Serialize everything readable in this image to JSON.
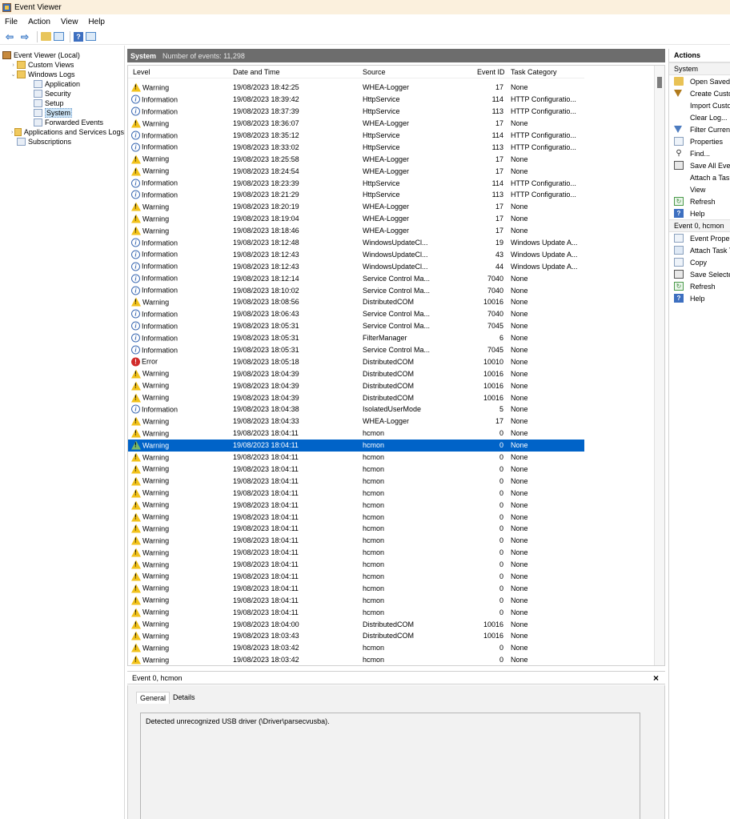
{
  "window": {
    "title": "Event Viewer"
  },
  "menu": [
    "File",
    "Action",
    "View",
    "Help"
  ],
  "tree": [
    {
      "label": "Event Viewer (Local)",
      "indent": 0,
      "chev": "",
      "icon": "root",
      "name": "tree-event-viewer-local"
    },
    {
      "label": "Custom Views",
      "indent": 1,
      "chev": "›",
      "icon": "folder",
      "name": "tree-custom-views"
    },
    {
      "label": "Windows Logs",
      "indent": 1,
      "chev": "⌄",
      "icon": "folder",
      "name": "tree-windows-logs"
    },
    {
      "label": "Application",
      "indent": 2,
      "chev": "",
      "icon": "log",
      "name": "tree-application"
    },
    {
      "label": "Security",
      "indent": 2,
      "chev": "",
      "icon": "log",
      "name": "tree-security"
    },
    {
      "label": "Setup",
      "indent": 2,
      "chev": "",
      "icon": "log",
      "name": "tree-setup"
    },
    {
      "label": "System",
      "indent": 2,
      "chev": "",
      "icon": "log",
      "name": "tree-system",
      "selected": true
    },
    {
      "label": "Forwarded Events",
      "indent": 2,
      "chev": "",
      "icon": "log",
      "name": "tree-forwarded-events"
    },
    {
      "label": "Applications and Services Logs",
      "indent": 1,
      "chev": "›",
      "icon": "folder",
      "name": "tree-applications-services-logs"
    },
    {
      "label": "Subscriptions",
      "indent": 1,
      "chev": "",
      "icon": "log",
      "name": "tree-subscriptions"
    }
  ],
  "center": {
    "log_name": "System",
    "count_label": "Number of events: 11,298",
    "columns": {
      "level": "Level",
      "date": "Date and Time",
      "source": "Source",
      "event_id": "Event ID",
      "category": "Task Category"
    },
    "selected_index": 30,
    "rows": [
      [
        "Warning",
        "19/08/2023 18:42:25",
        "WHEA-Logger",
        "17",
        "None"
      ],
      [
        "Information",
        "19/08/2023 18:39:42",
        "HttpService",
        "114",
        "HTTP Configuratio..."
      ],
      [
        "Information",
        "19/08/2023 18:37:39",
        "HttpService",
        "113",
        "HTTP Configuratio..."
      ],
      [
        "Warning",
        "19/08/2023 18:36:07",
        "WHEA-Logger",
        "17",
        "None"
      ],
      [
        "Information",
        "19/08/2023 18:35:12",
        "HttpService",
        "114",
        "HTTP Configuratio..."
      ],
      [
        "Information",
        "19/08/2023 18:33:02",
        "HttpService",
        "113",
        "HTTP Configuratio..."
      ],
      [
        "Warning",
        "19/08/2023 18:25:58",
        "WHEA-Logger",
        "17",
        "None"
      ],
      [
        "Warning",
        "19/08/2023 18:24:54",
        "WHEA-Logger",
        "17",
        "None"
      ],
      [
        "Information",
        "19/08/2023 18:23:39",
        "HttpService",
        "114",
        "HTTP Configuratio..."
      ],
      [
        "Information",
        "19/08/2023 18:21:29",
        "HttpService",
        "113",
        "HTTP Configuratio..."
      ],
      [
        "Warning",
        "19/08/2023 18:20:19",
        "WHEA-Logger",
        "17",
        "None"
      ],
      [
        "Warning",
        "19/08/2023 18:19:04",
        "WHEA-Logger",
        "17",
        "None"
      ],
      [
        "Warning",
        "19/08/2023 18:18:46",
        "WHEA-Logger",
        "17",
        "None"
      ],
      [
        "Information",
        "19/08/2023 18:12:48",
        "WindowsUpdateCl...",
        "19",
        "Windows Update A..."
      ],
      [
        "Information",
        "19/08/2023 18:12:43",
        "WindowsUpdateCl...",
        "43",
        "Windows Update A..."
      ],
      [
        "Information",
        "19/08/2023 18:12:43",
        "WindowsUpdateCl...",
        "44",
        "Windows Update A..."
      ],
      [
        "Information",
        "19/08/2023 18:12:14",
        "Service Control Ma...",
        "7040",
        "None"
      ],
      [
        "Information",
        "19/08/2023 18:10:02",
        "Service Control Ma...",
        "7040",
        "None"
      ],
      [
        "Warning",
        "19/08/2023 18:08:56",
        "DistributedCOM",
        "10016",
        "None"
      ],
      [
        "Information",
        "19/08/2023 18:06:43",
        "Service Control Ma...",
        "7040",
        "None"
      ],
      [
        "Information",
        "19/08/2023 18:05:31",
        "Service Control Ma...",
        "7045",
        "None"
      ],
      [
        "Information",
        "19/08/2023 18:05:31",
        "FilterManager",
        "6",
        "None"
      ],
      [
        "Information",
        "19/08/2023 18:05:31",
        "Service Control Ma...",
        "7045",
        "None"
      ],
      [
        "Error",
        "19/08/2023 18:05:18",
        "DistributedCOM",
        "10010",
        "None"
      ],
      [
        "Warning",
        "19/08/2023 18:04:39",
        "DistributedCOM",
        "10016",
        "None"
      ],
      [
        "Warning",
        "19/08/2023 18:04:39",
        "DistributedCOM",
        "10016",
        "None"
      ],
      [
        "Warning",
        "19/08/2023 18:04:39",
        "DistributedCOM",
        "10016",
        "None"
      ],
      [
        "Information",
        "19/08/2023 18:04:38",
        "IsolatedUserMode",
        "5",
        "None"
      ],
      [
        "Warning",
        "19/08/2023 18:04:33",
        "WHEA-Logger",
        "17",
        "None"
      ],
      [
        "Warning",
        "19/08/2023 18:04:11",
        "hcmon",
        "0",
        "None"
      ],
      [
        "Warning",
        "19/08/2023 18:04:11",
        "hcmon",
        "0",
        "None"
      ],
      [
        "Warning",
        "19/08/2023 18:04:11",
        "hcmon",
        "0",
        "None"
      ],
      [
        "Warning",
        "19/08/2023 18:04:11",
        "hcmon",
        "0",
        "None"
      ],
      [
        "Warning",
        "19/08/2023 18:04:11",
        "hcmon",
        "0",
        "None"
      ],
      [
        "Warning",
        "19/08/2023 18:04:11",
        "hcmon",
        "0",
        "None"
      ],
      [
        "Warning",
        "19/08/2023 18:04:11",
        "hcmon",
        "0",
        "None"
      ],
      [
        "Warning",
        "19/08/2023 18:04:11",
        "hcmon",
        "0",
        "None"
      ],
      [
        "Warning",
        "19/08/2023 18:04:11",
        "hcmon",
        "0",
        "None"
      ],
      [
        "Warning",
        "19/08/2023 18:04:11",
        "hcmon",
        "0",
        "None"
      ],
      [
        "Warning",
        "19/08/2023 18:04:11",
        "hcmon",
        "0",
        "None"
      ],
      [
        "Warning",
        "19/08/2023 18:04:11",
        "hcmon",
        "0",
        "None"
      ],
      [
        "Warning",
        "19/08/2023 18:04:11",
        "hcmon",
        "0",
        "None"
      ],
      [
        "Warning",
        "19/08/2023 18:04:11",
        "hcmon",
        "0",
        "None"
      ],
      [
        "Warning",
        "19/08/2023 18:04:11",
        "hcmon",
        "0",
        "None"
      ],
      [
        "Warning",
        "19/08/2023 18:04:11",
        "hcmon",
        "0",
        "None"
      ],
      [
        "Warning",
        "19/08/2023 18:04:00",
        "DistributedCOM",
        "10016",
        "None"
      ],
      [
        "Warning",
        "19/08/2023 18:03:43",
        "DistributedCOM",
        "10016",
        "None"
      ],
      [
        "Warning",
        "19/08/2023 18:03:42",
        "hcmon",
        "0",
        "None"
      ],
      [
        "Warning",
        "19/08/2023 18:03:42",
        "hcmon",
        "0",
        "None"
      ],
      [
        "Warning",
        "19/08/2023 18:03:42",
        "hcmon",
        "0",
        "None"
      ]
    ]
  },
  "detail": {
    "title": "Event 0, hcmon",
    "close": "×",
    "tabs": [
      "General",
      "Details"
    ],
    "message": "Detected unrecognized USB driver (\\Driver\\parsecvusba)."
  },
  "actions": {
    "title": "Actions",
    "section1": "System",
    "items1": [
      {
        "label": "Open Saved Log...",
        "icon": "folder",
        "name": "action-open-saved-log"
      },
      {
        "label": "Create Custom View...",
        "icon": "filter",
        "name": "action-create-custom-view"
      },
      {
        "label": "Import Custom View...",
        "icon": "none",
        "name": "action-import-custom-view"
      },
      {
        "label": "Clear Log...",
        "icon": "none",
        "name": "action-clear-log"
      },
      {
        "label": "Filter Current Log...",
        "icon": "filter-blue",
        "name": "action-filter-current-log"
      },
      {
        "label": "Properties",
        "icon": "page",
        "name": "action-properties"
      },
      {
        "label": "Find...",
        "icon": "binoc",
        "name": "action-find"
      },
      {
        "label": "Save All Events As...",
        "icon": "disk",
        "name": "action-save-all-events"
      },
      {
        "label": "Attach a Task To this Log...",
        "icon": "none",
        "name": "action-attach-task-log"
      },
      {
        "label": "View",
        "icon": "none",
        "name": "action-view"
      },
      {
        "label": "Refresh",
        "icon": "refresh",
        "name": "action-refresh"
      },
      {
        "label": "Help",
        "icon": "help",
        "name": "action-help"
      }
    ],
    "section2": "Event 0, hcmon",
    "items2": [
      {
        "label": "Event Properties",
        "icon": "page",
        "name": "action-event-properties"
      },
      {
        "label": "Attach Task To This Event...",
        "icon": "task",
        "name": "action-attach-task-event"
      },
      {
        "label": "Copy",
        "icon": "page",
        "name": "action-copy"
      },
      {
        "label": "Save Selected Events...",
        "icon": "disk",
        "name": "action-save-selected-events"
      },
      {
        "label": "Refresh",
        "icon": "refresh",
        "name": "action-refresh-event"
      },
      {
        "label": "Help",
        "icon": "help",
        "name": "action-help-event"
      }
    ]
  }
}
